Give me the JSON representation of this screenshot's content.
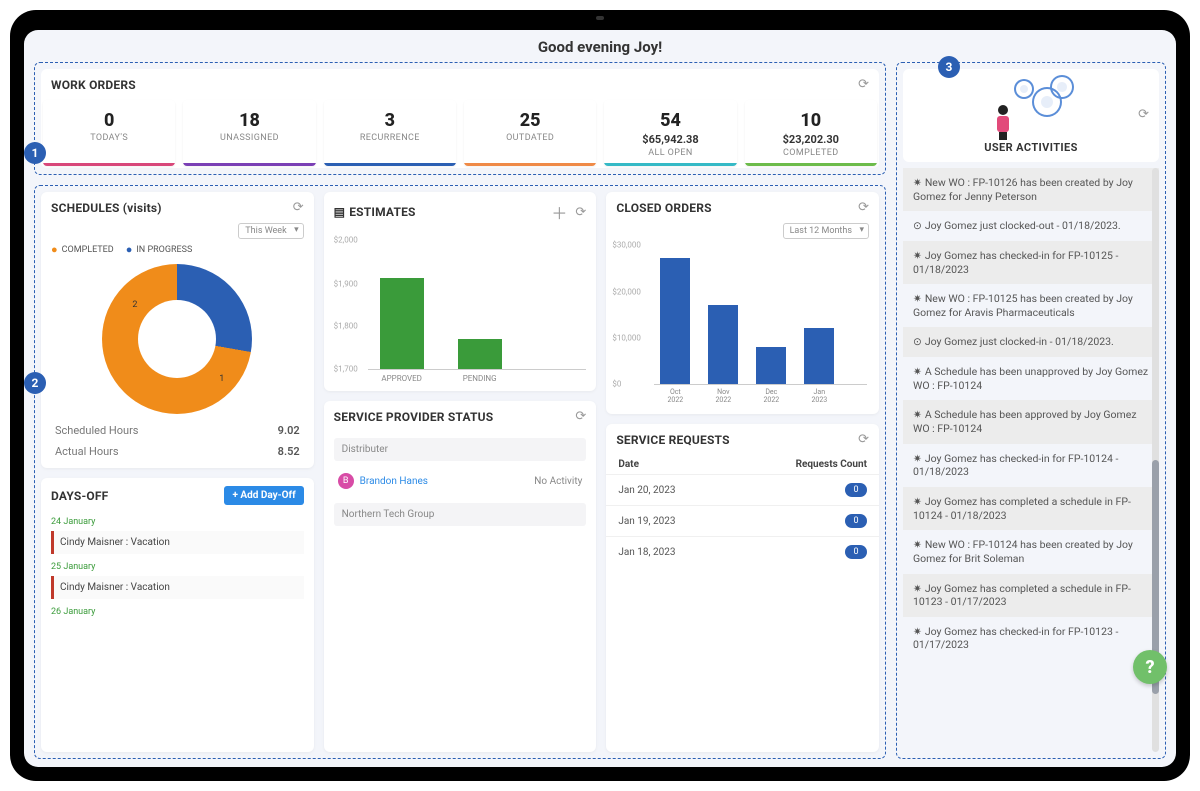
{
  "greeting": "Good evening Joy!",
  "work_orders": {
    "title": "WORK ORDERS",
    "tiles": [
      {
        "big": "0",
        "sub": "",
        "label": "TODAY'S",
        "accent": "#d8477a"
      },
      {
        "big": "18",
        "sub": "",
        "label": "UNASSIGNED",
        "accent": "#7a3fb5"
      },
      {
        "big": "3",
        "sub": "",
        "label": "RECURRENCE",
        "accent": "#2b5fb3"
      },
      {
        "big": "25",
        "sub": "",
        "label": "OUTDATED",
        "accent": "#ef8a47"
      },
      {
        "big": "54",
        "sub": "$65,942.38",
        "label": "ALL OPEN",
        "accent": "#35b9c6"
      },
      {
        "big": "10",
        "sub": "$23,202.30",
        "label": "COMPLETED",
        "accent": "#6cbb4a"
      }
    ]
  },
  "schedules": {
    "title": "SCHEDULES (visits)",
    "range": "This Week",
    "legend": {
      "completed": "COMPLETED",
      "in_progress": "IN PROGRESS"
    },
    "donut_labels": {
      "seg1": "2",
      "seg2": "1"
    },
    "scheduled_label": "Scheduled Hours",
    "scheduled_value": "9.02",
    "actual_label": "Actual Hours",
    "actual_value": "8.52"
  },
  "estimates": {
    "title": "ESTIMATES"
  },
  "closed_orders": {
    "title": "CLOSED ORDERS",
    "range": "Last 12 Months"
  },
  "days_off": {
    "title": "DAYS-OFF",
    "add_label": "+ Add Day-Off",
    "items": [
      {
        "date": "24 January",
        "text": "Cindy Maisner : Vacation"
      },
      {
        "date": "25 January",
        "text": "Cindy Maisner : Vacation"
      },
      {
        "date": "26 January",
        "text": ""
      }
    ]
  },
  "service_provider": {
    "title": "SERVICE PROVIDER STATUS",
    "group": "Distributer",
    "name": "Brandon Hanes",
    "initial": "B",
    "status": "No Activity",
    "group2": "Northern Tech Group"
  },
  "service_requests": {
    "title": "SERVICE REQUESTS",
    "col_date": "Date",
    "col_count": "Requests Count",
    "rows": [
      {
        "date": "Jan 20, 2023",
        "count": "0"
      },
      {
        "date": "Jan 19, 2023",
        "count": "0"
      },
      {
        "date": "Jan 18, 2023",
        "count": "0"
      }
    ]
  },
  "user_activities": {
    "title": "USER ACTIVITIES",
    "items": [
      {
        "icon": "✷",
        "text": "New WO : FP-10126 has been created by Joy Gomez for Jenny Peterson"
      },
      {
        "icon": "⊙",
        "text": "Joy Gomez just clocked-out - 01/18/2023."
      },
      {
        "icon": "✷",
        "text": "Joy Gomez has checked-in for FP-10125 - 01/18/2023"
      },
      {
        "icon": "✷",
        "text": "New WO : FP-10125 has been created by Joy Gomez for Aravis Pharmaceuticals"
      },
      {
        "icon": "⊙",
        "text": "Joy Gomez just clocked-in - 01/18/2023."
      },
      {
        "icon": "✷",
        "text": "A Schedule has been unapproved by Joy Gomez WO : FP-10124"
      },
      {
        "icon": "✷",
        "text": "A Schedule has been approved by Joy Gomez WO : FP-10124"
      },
      {
        "icon": "✷",
        "text": "Joy Gomez has checked-in for FP-10124 - 01/18/2023"
      },
      {
        "icon": "✷",
        "text": "Joy Gomez has completed a schedule in FP-10124 - 01/18/2023"
      },
      {
        "icon": "✷",
        "text": "New WO : FP-10124 has been created by Joy Gomez for Brit Soleman"
      },
      {
        "icon": "✷",
        "text": "Joy Gomez has completed a schedule in FP-10123 - 01/17/2023"
      },
      {
        "icon": "✷",
        "text": "Joy Gomez has checked-in for FP-10123 - 01/17/2023"
      }
    ]
  },
  "chart_data": [
    {
      "type": "pie",
      "title": "SCHEDULES (visits)",
      "series": [
        {
          "name": "COMPLETED",
          "value": 1,
          "color": "#f08c1a"
        },
        {
          "name": "IN PROGRESS",
          "value": 2,
          "color": "#2b5fb3"
        }
      ],
      "donut": true
    },
    {
      "type": "bar",
      "title": "ESTIMATES",
      "categories": [
        "APPROVED",
        "PENDING"
      ],
      "values": [
        1910,
        1770
      ],
      "ylabel": "",
      "ylim": [
        1700,
        2000
      ],
      "yticks": [
        1700,
        1800,
        1900,
        2000
      ],
      "color": "#3a9b3a"
    },
    {
      "type": "bar",
      "title": "CLOSED ORDERS",
      "categories": [
        "Oct 2022",
        "Nov 2022",
        "Dec 2022",
        "Jan 2023"
      ],
      "values": [
        27000,
        17000,
        8000,
        12000
      ],
      "ylabel": "",
      "ylim": [
        0,
        30000
      ],
      "yticks": [
        0,
        10000,
        20000,
        30000
      ],
      "color": "#2b5fb3"
    }
  ]
}
